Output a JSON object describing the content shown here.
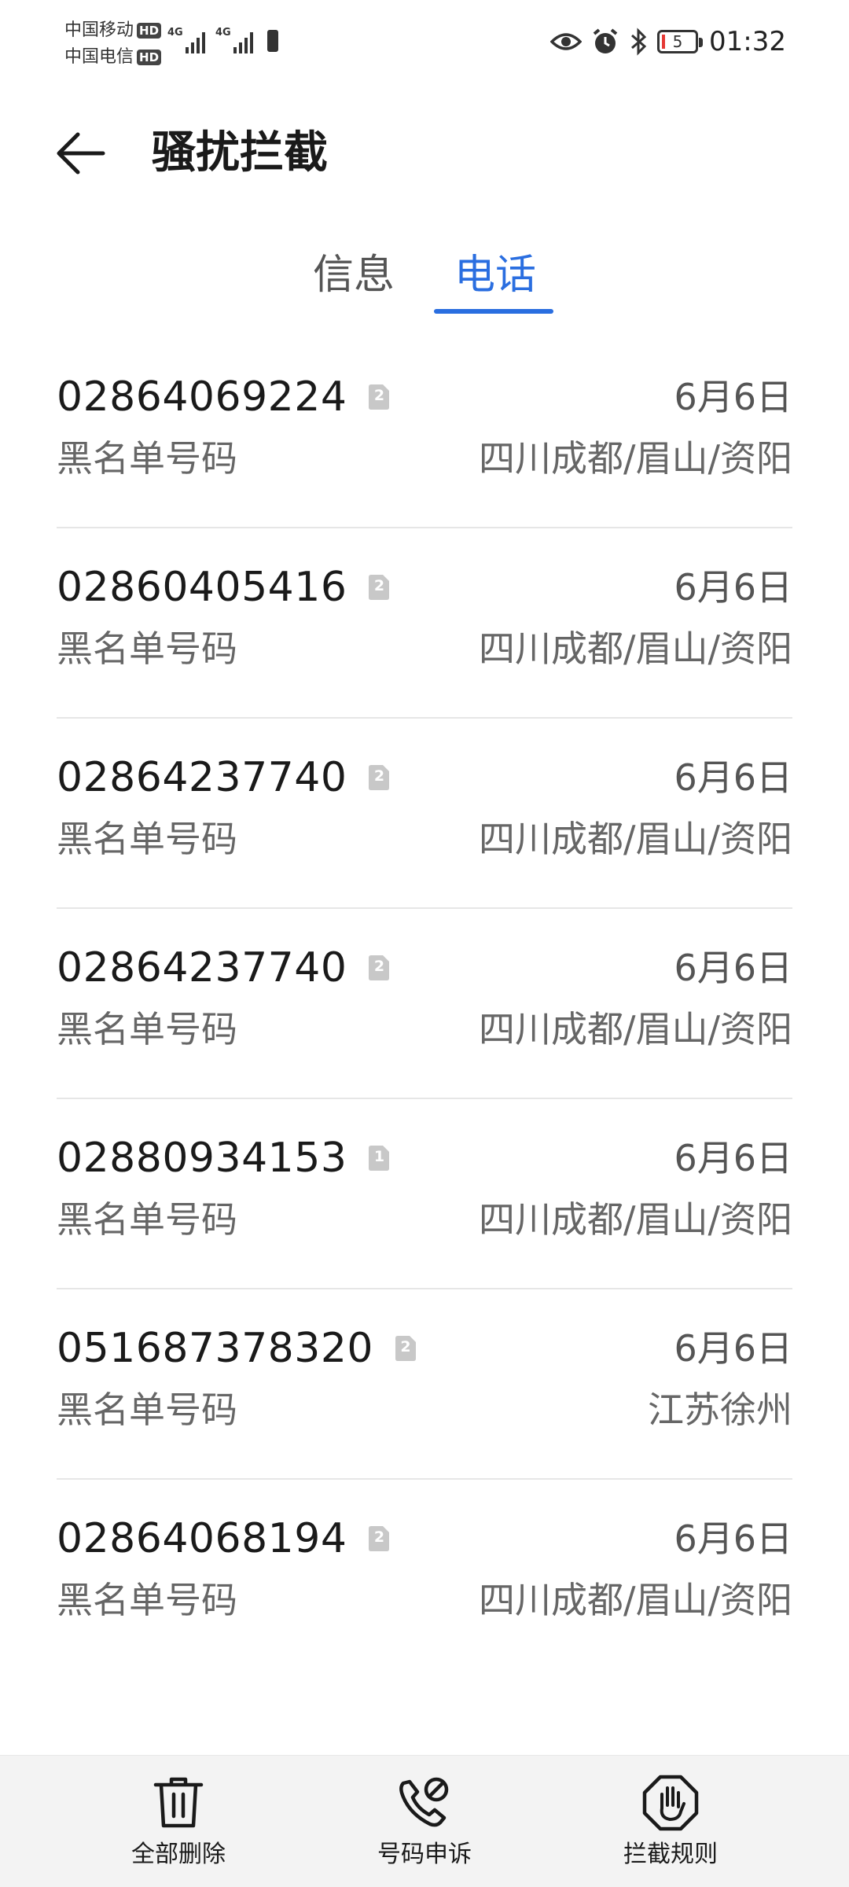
{
  "status_bar": {
    "carrier1": "中国移动",
    "carrier2": "中国电信",
    "hd_badge": "HD",
    "network1": "4G",
    "network2": "4G",
    "battery_level": "5",
    "time": "01:32",
    "icons": [
      "eye-icon",
      "alarm-icon",
      "bluetooth-icon",
      "battery-icon"
    ]
  },
  "header": {
    "title": "骚扰拦截",
    "back_icon": "arrow-left-icon"
  },
  "tabs": [
    {
      "label": "信息",
      "selected": false
    },
    {
      "label": "电话",
      "selected": true
    }
  ],
  "accent_color": "#2a6ee0",
  "calls": [
    {
      "number": "02864069224",
      "sim": "2",
      "date": "6月6日",
      "type": "黑名单号码",
      "location": "四川成都/眉山/资阳"
    },
    {
      "number": "02860405416",
      "sim": "2",
      "date": "6月6日",
      "type": "黑名单号码",
      "location": "四川成都/眉山/资阳"
    },
    {
      "number": "02864237740",
      "sim": "2",
      "date": "6月6日",
      "type": "黑名单号码",
      "location": "四川成都/眉山/资阳"
    },
    {
      "number": "02864237740",
      "sim": "2",
      "date": "6月6日",
      "type": "黑名单号码",
      "location": "四川成都/眉山/资阳"
    },
    {
      "number": "02880934153",
      "sim": "1",
      "date": "6月6日",
      "type": "黑名单号码",
      "location": "四川成都/眉山/资阳"
    },
    {
      "number": "051687378320",
      "sim": "2",
      "date": "6月6日",
      "type": "黑名单号码",
      "location": "江苏徐州"
    },
    {
      "number": "02864068194",
      "sim": "2",
      "date": "6月6日",
      "type": "黑名单号码",
      "location": "四川成都/眉山/资阳"
    }
  ],
  "bottom_bar": {
    "delete_all": "全部删除",
    "number_appeal": "号码申诉",
    "block_rules": "拦截规则",
    "icons": [
      "trash-icon",
      "phone-appeal-icon",
      "hand-stop-icon"
    ]
  }
}
